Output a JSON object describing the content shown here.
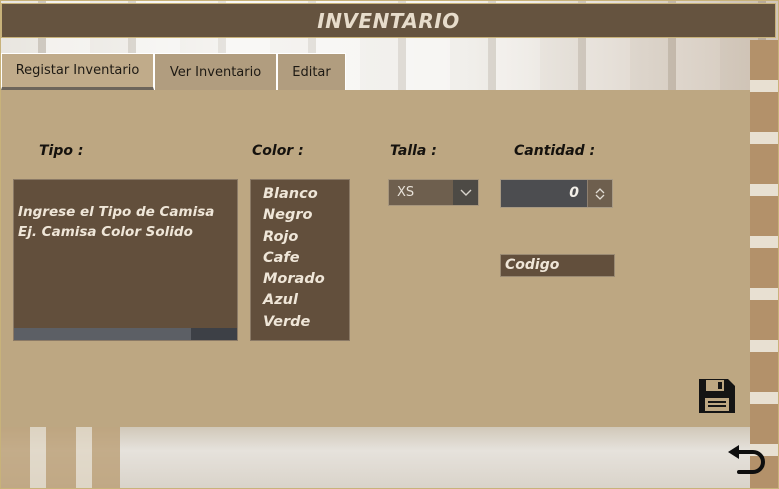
{
  "window": {
    "title": "INVENTARIO"
  },
  "tabs": [
    {
      "label": "Registar Inventario",
      "active": true
    },
    {
      "label": "Ver Inventario",
      "active": false
    },
    {
      "label": "Editar",
      "active": false
    }
  ],
  "form": {
    "tipo": {
      "label": "Tipo :",
      "placeholder": "Ingrese el Tipo de Camisa\nEj. Camisa Color Solido"
    },
    "color": {
      "label": "Color :",
      "options": [
        "Blanco",
        "Negro",
        "Rojo",
        "Cafe",
        "Morado",
        "Azul",
        "Verde"
      ]
    },
    "talla": {
      "label": "Talla :",
      "selected": "XS"
    },
    "cantidad": {
      "label": "Cantidad :",
      "value": "0"
    },
    "codigo": {
      "placeholder": "Codigo"
    }
  },
  "icons": {
    "save": "floppy-disk-icon",
    "back": "undo-arrow-icon"
  },
  "colors": {
    "titlebar": "#65533f",
    "panel": "#bda782",
    "field": "#624f3c",
    "field_text": "#efe6d8"
  }
}
